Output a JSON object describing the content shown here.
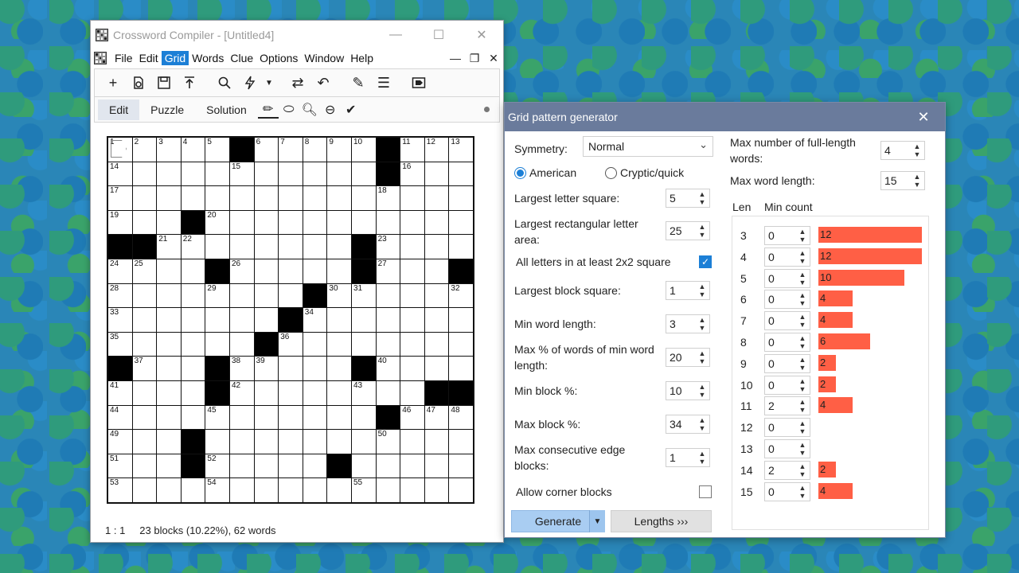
{
  "main_window": {
    "title": "Crossword Compiler - [Untitled4]",
    "window_controls": [
      "—",
      "☐",
      "✕"
    ],
    "menu": [
      "File",
      "Edit",
      "Grid",
      "Words",
      "Clue",
      "Options",
      "Window",
      "Help"
    ],
    "active_menu": "Grid",
    "mdi_controls": [
      "—",
      "❐",
      "✕"
    ],
    "modes": [
      "Edit",
      "Puzzle",
      "Solution"
    ],
    "active_mode": "Edit",
    "status": {
      "position": "1 : 1",
      "summary": "23 blocks (10.22%), 62 words"
    }
  },
  "grid": {
    "size": 15,
    "blocks": [
      [
        0,
        5
      ],
      [
        0,
        11
      ],
      [
        1,
        11
      ],
      [
        3,
        3
      ],
      [
        4,
        0
      ],
      [
        4,
        1
      ],
      [
        4,
        10
      ],
      [
        5,
        4
      ],
      [
        5,
        10
      ],
      [
        5,
        14
      ],
      [
        6,
        8
      ],
      [
        7,
        7
      ],
      [
        8,
        6
      ],
      [
        9,
        0
      ],
      [
        9,
        4
      ],
      [
        9,
        10
      ],
      [
        10,
        4
      ],
      [
        10,
        13
      ],
      [
        10,
        14
      ],
      [
        11,
        11
      ],
      [
        12,
        3
      ],
      [
        13,
        3
      ],
      [
        13,
        9
      ]
    ],
    "numbers": {
      "0,0": "1",
      "0,1": "2",
      "0,2": "3",
      "0,3": "4",
      "0,4": "5",
      "0,6": "6",
      "0,7": "7",
      "0,8": "8",
      "0,9": "9",
      "0,10": "10",
      "0,12": "11",
      "0,13": "12",
      "0,14": "13",
      "1,0": "14",
      "1,5": "15",
      "1,12": "16",
      "2,0": "17",
      "2,11": "18",
      "3,0": "19",
      "3,4": "20",
      "4,2": "21",
      "4,3": "22",
      "4,11": "23",
      "5,0": "24",
      "5,1": "25",
      "5,5": "26",
      "5,11": "27",
      "6,0": "28",
      "6,4": "29",
      "6,9": "30",
      "6,10": "31",
      "6,14": "32",
      "7,0": "33",
      "7,8": "34",
      "8,0": "35",
      "8,7": "36",
      "9,1": "37",
      "9,5": "38",
      "9,6": "39",
      "9,11": "40",
      "10,0": "41",
      "10,5": "42",
      "10,10": "43",
      "11,0": "44",
      "11,4": "45",
      "11,12": "46",
      "11,13": "47",
      "11,14": "48",
      "12,0": "49",
      "12,11": "50",
      "13,0": "51",
      "13,4": "52",
      "14,0": "53",
      "14,4": "54",
      "14,10": "55"
    }
  },
  "dialog": {
    "title": "Grid pattern generator",
    "symmetry_label": "Symmetry:",
    "symmetry_value": "Normal",
    "radio_american": "American",
    "radio_cryptic": "Cryptic/quick",
    "radio_selected": "American",
    "fields": {
      "largest_letter_square": {
        "label": "Largest letter square:",
        "value": "5"
      },
      "largest_rect_area": {
        "label": "Largest rectangular letter area:",
        "value": "25"
      },
      "all_letters_2x2": {
        "label": "All letters in at least 2x2 square",
        "checked": true
      },
      "largest_block_square": {
        "label": "Largest block square:",
        "value": "1"
      },
      "min_word_length": {
        "label": "Min word length:",
        "value": "3"
      },
      "max_pct_min_words": {
        "label": "Max % of words of min word length:",
        "value": "20"
      },
      "min_block_pct": {
        "label": "Min block %:",
        "value": "10"
      },
      "max_block_pct": {
        "label": "Max block %:",
        "value": "34"
      },
      "max_consec_edge": {
        "label": "Max consecutive edge blocks:",
        "value": "1"
      },
      "allow_corner_blocks": {
        "label": "Allow corner blocks",
        "checked": false
      },
      "max_full_length": {
        "label": "Max number of full-length words:",
        "value": "4"
      },
      "max_word_length": {
        "label": "Max word length:",
        "value": "15"
      }
    },
    "len_header": "Len",
    "min_count_header": "Min count",
    "lengths": [
      {
        "len": "3",
        "min": "0",
        "count": 12
      },
      {
        "len": "4",
        "min": "0",
        "count": 12
      },
      {
        "len": "5",
        "min": "0",
        "count": 10
      },
      {
        "len": "6",
        "min": "0",
        "count": 4
      },
      {
        "len": "7",
        "min": "0",
        "count": 4
      },
      {
        "len": "8",
        "min": "0",
        "count": 6
      },
      {
        "len": "9",
        "min": "0",
        "count": 2
      },
      {
        "len": "10",
        "min": "0",
        "count": 2
      },
      {
        "len": "11",
        "min": "2",
        "count": 4
      },
      {
        "len": "12",
        "min": "0",
        "count": 0
      },
      {
        "len": "13",
        "min": "0",
        "count": 0
      },
      {
        "len": "14",
        "min": "2",
        "count": 2
      },
      {
        "len": "15",
        "min": "0",
        "count": 4
      }
    ],
    "generate_label": "Generate",
    "lengths_button": "Lengths ›››"
  }
}
